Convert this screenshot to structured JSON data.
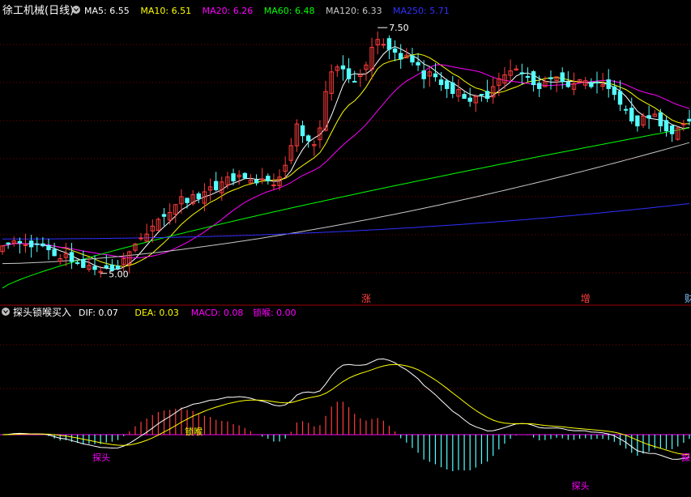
{
  "main_panel": {
    "title": "徐工机械(日线)",
    "legend": [
      {
        "label": "MA5: 6.55",
        "color": "#ffffff"
      },
      {
        "label": "MA10: 6.51",
        "color": "#ffff00"
      },
      {
        "label": "MA20: 6.26",
        "color": "#ff00ff"
      },
      {
        "label": "MA60: 6.48",
        "color": "#00ff00"
      },
      {
        "label": "MA120: 6.33",
        "color": "#c8c8c8"
      },
      {
        "label": "MA250: 5.71",
        "color": "#3030ff"
      }
    ],
    "high_annotation": "7.50",
    "low_annotation": "5.00",
    "markers": [
      {
        "text": "涨",
        "color": "#ff4040",
        "index": 63
      },
      {
        "text": "增",
        "color": "#ff4040",
        "index": 101
      },
      {
        "text": "财",
        "color": "#80c0ff",
        "index": 130
      }
    ]
  },
  "indicator_panel": {
    "title": "探头锁喉买入",
    "legend": [
      {
        "label": "DIF: 0.07",
        "color": "#ffffff"
      },
      {
        "label": "DEA: 0.03",
        "color": "#ffff00"
      },
      {
        "label": "MACD: 0.08",
        "color": "#ff00ff"
      },
      {
        "label": "锁喉: 0.00",
        "color": "#ff00ff"
      }
    ],
    "signals": [
      {
        "text": "探头",
        "color": "#ff00ff",
        "index": 17,
        "pos": "low"
      },
      {
        "text": "锁喉",
        "color": "#ffff00",
        "index": 33,
        "pos": "mid"
      },
      {
        "text": "探头",
        "color": "#ff00ff",
        "index": 100,
        "pos": "low2"
      },
      {
        "text": "探头",
        "color": "#ff00ff",
        "index": 135,
        "pos": "low3"
      },
      {
        "text": "探头",
        "color": "#ff00ff",
        "index": 141,
        "pos": "low3"
      }
    ]
  },
  "colors": {
    "up": "#ff3c3c",
    "down": "#54ffff",
    "grid": "#7a0000",
    "panel_border": "#a00000"
  },
  "chart_data": {
    "type": "candlestick",
    "price_range": [
      4.8,
      7.6
    ],
    "macd_range": [
      -0.55,
      0.55
    ],
    "close": [
      5.28,
      5.3,
      5.33,
      5.31,
      5.29,
      5.27,
      5.3,
      5.28,
      5.24,
      5.18,
      5.15,
      5.2,
      5.12,
      5.1,
      5.06,
      5.08,
      5.04,
      5.02,
      5.06,
      5.03,
      5.05,
      5.15,
      5.22,
      5.3,
      5.36,
      5.4,
      5.48,
      5.55,
      5.58,
      5.62,
      5.7,
      5.78,
      5.72,
      5.8,
      5.76,
      5.83,
      5.88,
      5.85,
      5.93,
      5.98,
      5.94,
      6.0,
      5.97,
      5.95,
      5.92,
      5.96,
      5.94,
      5.9,
      5.98,
      6.1,
      6.3,
      6.52,
      6.4,
      6.35,
      6.31,
      6.48,
      6.85,
      7.05,
      7.1,
      7.08,
      6.98,
      6.95,
      7.02,
      7.12,
      7.3,
      7.38,
      7.33,
      7.28,
      7.25,
      7.18,
      7.22,
      7.15,
      7.12,
      6.98,
      7.05,
      7.0,
      6.92,
      6.88,
      6.83,
      6.87,
      6.78,
      6.75,
      6.8,
      6.82,
      6.78,
      6.9,
      6.98,
      7.02,
      7.06,
      7.08,
      7.03,
      7.0,
      6.92,
      6.88,
      6.95,
      6.98,
      7.0,
      6.95,
      6.9,
      6.93,
      6.97,
      6.96,
      6.9,
      6.94,
      6.92,
      6.88,
      6.82,
      6.72,
      6.66,
      6.55,
      6.5,
      6.6,
      6.58,
      6.62,
      6.5,
      6.45,
      6.42,
      6.48,
      6.52,
      6.55
    ],
    "ma5_last": 6.55,
    "ma10_last": 6.51,
    "ma20_last": 6.26,
    "ma60_last": 6.48,
    "ma120_last": 6.33,
    "ma250_last": 5.71,
    "macd_hist_peak": 0.28,
    "macd_hist_trough": -0.38
  }
}
